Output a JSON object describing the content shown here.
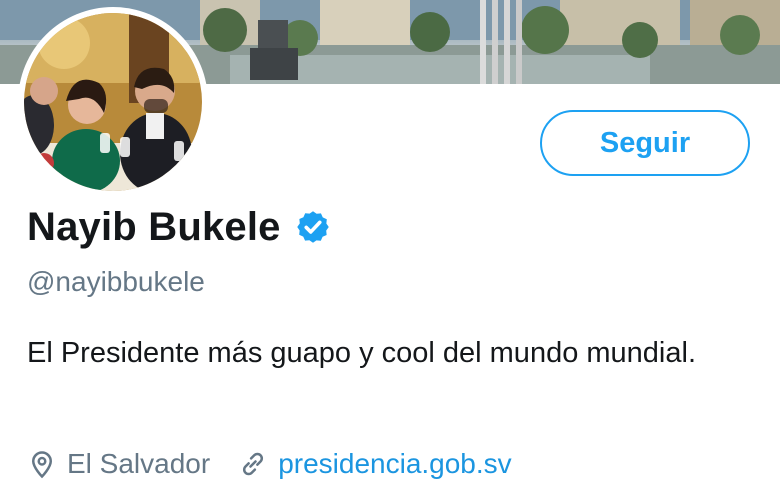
{
  "profile": {
    "display_name": "Nayib Bukele",
    "verified": true,
    "handle": "@nayibbukele",
    "bio": "El Presidente más guapo y cool del mundo mundial.",
    "location": "El Salvador",
    "website": "presidencia.gob.sv"
  },
  "actions": {
    "follow_label": "Seguir"
  },
  "colors": {
    "accent": "#1da1f2",
    "link": "#1b95e0",
    "text": "#14171a",
    "secondary": "#657786"
  },
  "icons": {
    "verified": "verified-badge-icon",
    "location": "location-pin-icon",
    "link": "link-icon"
  }
}
